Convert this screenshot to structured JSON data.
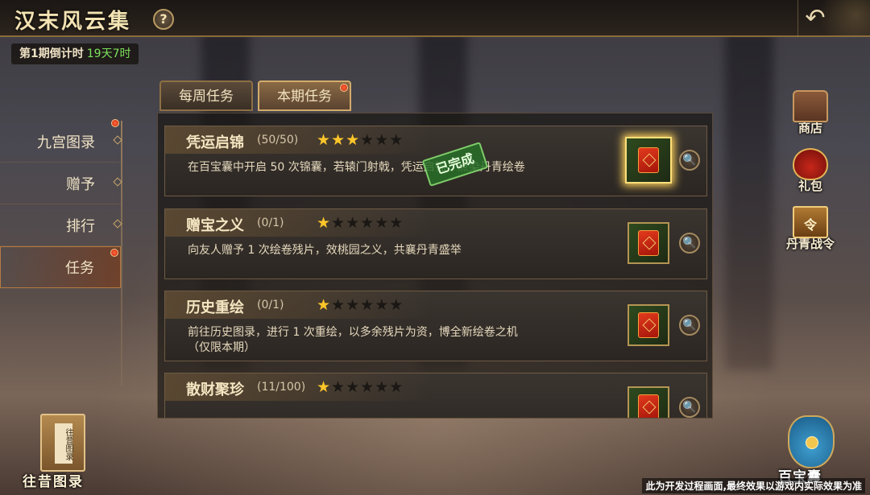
{
  "header": {
    "title": "汉末风云集",
    "help_label": "?",
    "back_icon": "back-arrow-icon",
    "countdown_label": "第1期倒计时",
    "countdown_value": "19天7时"
  },
  "nav": {
    "items": [
      {
        "label": "九宫图录",
        "badge": true
      },
      {
        "label": "赠予",
        "badge": false
      },
      {
        "label": "排行",
        "badge": false
      },
      {
        "label": "任务",
        "badge": true,
        "active": true
      }
    ]
  },
  "tabs": [
    {
      "label": "每周任务",
      "active": false
    },
    {
      "label": "本期任务",
      "active": true,
      "badge": true
    }
  ],
  "tasks": [
    {
      "name": "凭运启锦",
      "progress": "(50/50)",
      "stars": 3,
      "max_stars": 6,
      "desc": "在百宝囊中开启 50 次锦囊，若辕门射戟，凭运启锦，点染丹青绘卷",
      "completed": true,
      "completed_label": "已完成",
      "reward_icon": "red-pouch-icon"
    },
    {
      "name": "赠宝之义",
      "progress": "(0/1)",
      "stars": 1,
      "max_stars": 6,
      "desc": "向友人赠予 1 次绘卷残片，效桃园之义，共襄丹青盛举",
      "completed": false,
      "reward_icon": "red-pouch-icon"
    },
    {
      "name": "历史重绘",
      "progress": "(0/1)",
      "stars": 1,
      "max_stars": 6,
      "desc": "前往历史图录，进行 1 次重绘，以多余残片为资，博全新绘卷之机（仅限本期）",
      "completed": false,
      "reward_icon": "red-pouch-icon"
    },
    {
      "name": "散财聚珍",
      "progress": "(11/100)",
      "stars": 1,
      "max_stars": 6,
      "desc": "",
      "completed": false,
      "reward_icon": "red-pouch-icon"
    }
  ],
  "side_buttons": [
    {
      "label": "商店",
      "icon": "treasure-chest-icon"
    },
    {
      "label": "礼包",
      "icon": "gift-bag-icon"
    },
    {
      "label": "丹青战令",
      "icon": "battle-order-icon",
      "icon_glyph": "令"
    }
  ],
  "archive": {
    "label": "往昔图录",
    "book_text": "往昔图录"
  },
  "treasure": {
    "label": "百宝囊"
  },
  "disclaimer": "此为开发过程画面,最终效果以游戏内实际效果为准",
  "colors": {
    "accent_gold": "#d3ab6b",
    "countdown_green": "#7de25a",
    "star_gold": "#ffc62a",
    "badge_red": "#c8230e",
    "stamp_green": "#286e28"
  }
}
